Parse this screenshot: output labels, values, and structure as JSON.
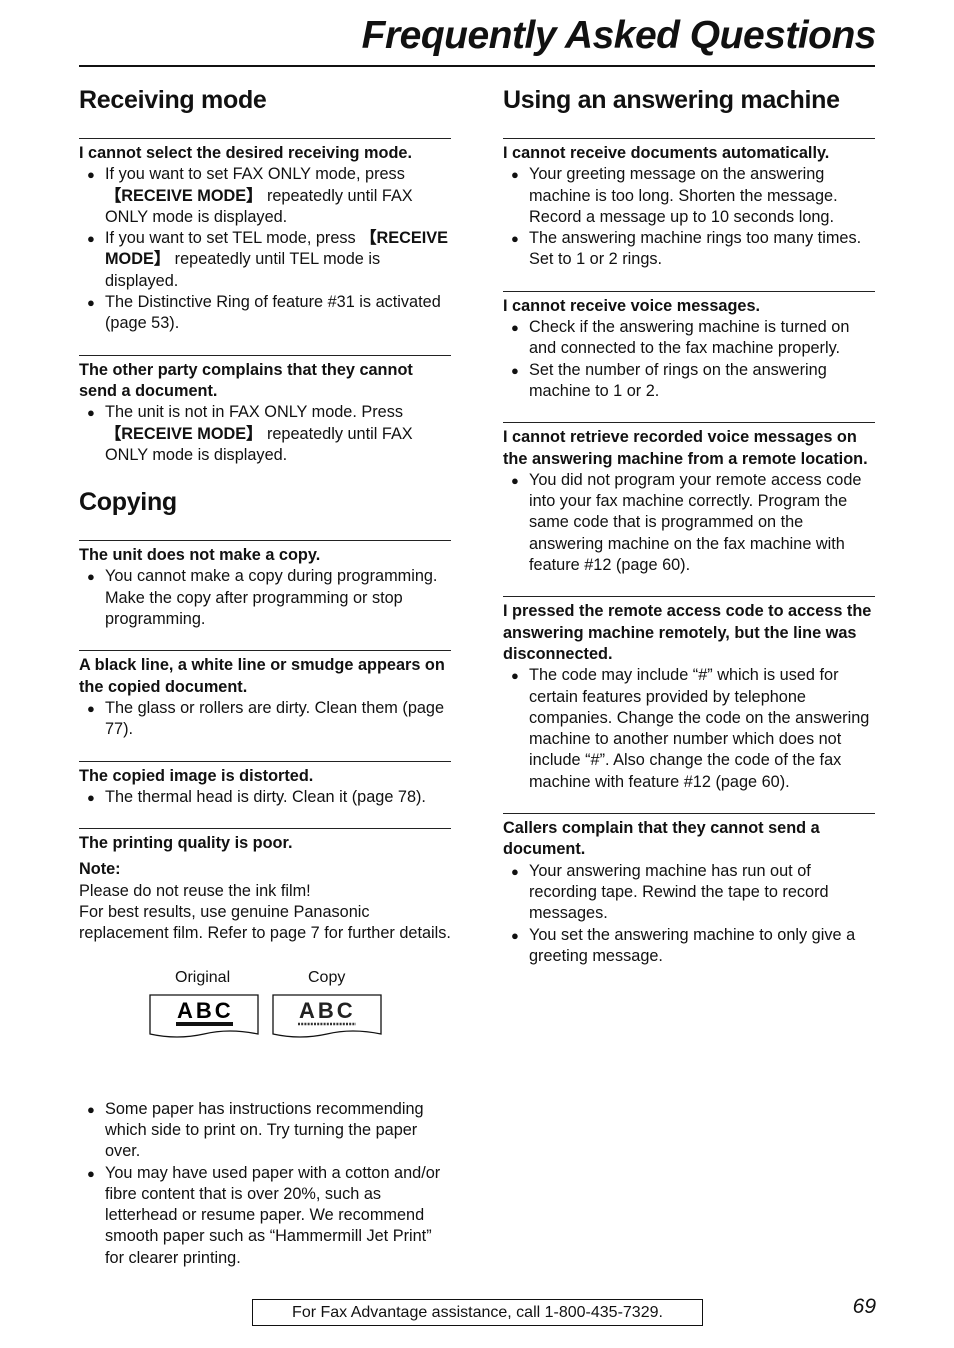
{
  "header": {
    "title": "Frequently Asked Questions"
  },
  "left": {
    "receiving": {
      "heading": "Receiving mode",
      "faqs": [
        {
          "q": "I cannot select the desired receiving mode.",
          "a": [
            {
              "pre": "If you want to set FAX ONLY mode, press ",
              "key": "【RECEIVE MODE】",
              "post": " repeatedly until FAX ONLY mode is displayed."
            },
            {
              "pre": "If you want to set TEL mode, press ",
              "key": "【RECEIVE MODE】",
              "post": " repeatedly until TEL mode is displayed."
            },
            {
              "pre": "The Distinctive Ring of feature #31 is activated (page 53).",
              "key": "",
              "post": ""
            }
          ]
        },
        {
          "q": "The other party complains that they cannot send a document.",
          "a": [
            {
              "pre": "The unit is not in FAX ONLY mode. Press ",
              "key": "【RECEIVE MODE】",
              "post": " repeatedly until FAX ONLY mode is displayed."
            }
          ]
        }
      ]
    },
    "copying": {
      "heading": "Copying",
      "faqs": [
        {
          "q": "The unit does not make a copy.",
          "a": [
            "You cannot make a copy during programming. Make the copy after programming or stop programming."
          ]
        },
        {
          "q": "A black line, a white line or smudge appears on the copied document.",
          "a": [
            "The glass or rollers are dirty. Clean them (page 77)."
          ]
        },
        {
          "q": "The copied image is distorted.",
          "a": [
            "The thermal head is dirty. Clean it (page 78)."
          ]
        },
        {
          "q": "The printing quality is poor.",
          "note_label": "Note:",
          "note_lines": [
            "Please do not reuse the ink film!",
            "For best results, use genuine Panasonic replacement film. Refer to page 7 for further details."
          ],
          "figure": {
            "original_label": "Original",
            "copy_label": "Copy",
            "sample_text": "ABC"
          },
          "a": [
            "Some paper has instructions recommending which side to print on. Try turning the paper over.",
            "You may have used paper with a cotton and/or fibre content that is over 20%, such as letterhead or resume paper. We recommend smooth paper such as “Hammermill Jet Print” for clearer printing."
          ]
        }
      ]
    }
  },
  "right": {
    "answering": {
      "heading": "Using an answering machine",
      "faqs": [
        {
          "q": "I cannot receive documents automatically.",
          "a": [
            "Your greeting message on the answering machine is too long. Shorten the message. Record a message up to 10 seconds long.",
            "The answering machine rings too many times. Set to 1 or 2 rings."
          ]
        },
        {
          "q": "I cannot receive voice messages.",
          "a": [
            "Check if the answering machine is turned on and connected to the fax machine properly.",
            "Set the number of rings on the answering machine to 1 or 2."
          ]
        },
        {
          "q": "I cannot retrieve recorded voice messages on the answering machine from a remote location.",
          "a": [
            "You did not program your remote access code into your fax machine correctly. Program the same code that is programmed on the answering machine on the fax machine with feature #12 (page 60)."
          ]
        },
        {
          "q": "I pressed the remote access code to access the answering machine remotely, but the line was disconnected.",
          "a": [
            "The code may include “#” which is used for certain features provided by telephone companies. Change the code on the answering machine to another number which does not include “#”. Also change the code of the fax machine with feature #12 (page 60)."
          ]
        },
        {
          "q": "Callers complain that they cannot send a document.",
          "a": [
            "Your answering machine has run out of recording tape. Rewind the tape to record messages.",
            "You set the answering machine to only give a greeting message."
          ]
        }
      ]
    }
  },
  "footer": {
    "assistance": "For Fax Advantage assistance, call 1-800-435-7329.",
    "page_number": "69"
  },
  "icons": {
    "bullet": "●"
  }
}
